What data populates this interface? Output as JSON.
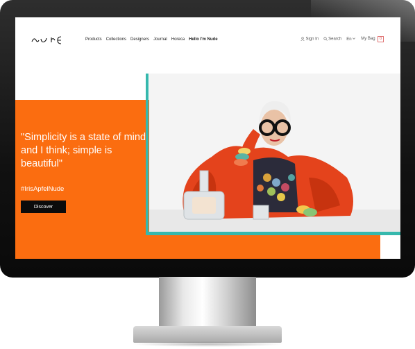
{
  "site": {
    "brand": "nude",
    "nav": [
      {
        "label": "Products"
      },
      {
        "label": "Collections"
      },
      {
        "label": "Designers"
      },
      {
        "label": "Journal"
      },
      {
        "label": "Horeca"
      },
      {
        "label": "Hello I'm Nude"
      }
    ],
    "utility": {
      "sign_in": "Sign In",
      "search": "Search",
      "language": "En",
      "bag_label": "My Bag",
      "bag_count": "0"
    }
  },
  "hero": {
    "quote": "\"Simplicity is a state of mind and I think; simple is beautiful\"",
    "hashtag": "#IrisApfelNude",
    "cta": "Discover"
  },
  "colors": {
    "accent_orange": "#fb6d10",
    "accent_teal": "#36b8ad",
    "button_bg": "#0b0b0b"
  }
}
